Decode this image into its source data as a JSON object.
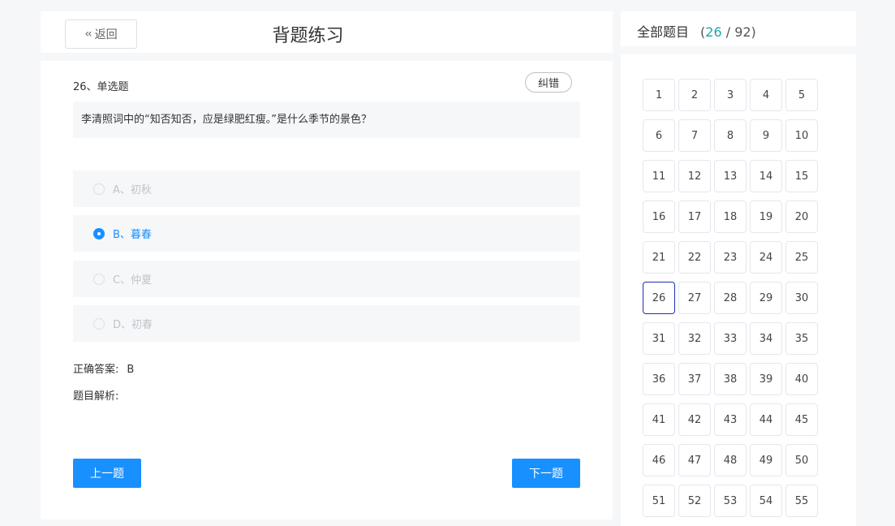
{
  "header": {
    "back_label": "返回",
    "title": "背题练习"
  },
  "question": {
    "type_label": "26、单选题",
    "report_label": "纠错",
    "stem": "李清照词中的“知否知否，应是绿肥红瘦。”是什么季节的景色？",
    "options": [
      {
        "label": "A、初秋",
        "selected": false
      },
      {
        "label": "B、暮春",
        "selected": true
      },
      {
        "label": "C、仲夏",
        "selected": false
      },
      {
        "label": "D、初春",
        "selected": false
      }
    ],
    "answer_label": "正确答案:",
    "answer_value": "B",
    "analysis_label": "题目解析:"
  },
  "nav": {
    "prev_label": "上一题",
    "next_label": "下一题"
  },
  "sidebar": {
    "title": "全部题目",
    "current": "26",
    "total": "92",
    "numbers": [
      "1",
      "2",
      "3",
      "4",
      "5",
      "6",
      "7",
      "8",
      "9",
      "10",
      "11",
      "12",
      "13",
      "14",
      "15",
      "16",
      "17",
      "18",
      "19",
      "20",
      "21",
      "22",
      "23",
      "24",
      "25",
      "26",
      "27",
      "28",
      "29",
      "30",
      "31",
      "32",
      "33",
      "34",
      "35",
      "36",
      "37",
      "38",
      "39",
      "40",
      "41",
      "42",
      "43",
      "44",
      "45",
      "46",
      "47",
      "48",
      "49",
      "50",
      "51",
      "52",
      "53",
      "54",
      "55"
    ]
  },
  "colors": {
    "accent": "#1890ff",
    "counter_current": "#19a9a4",
    "active_border": "#1f2db5"
  },
  "icons": {
    "back": "double-chevron-left-icon"
  }
}
